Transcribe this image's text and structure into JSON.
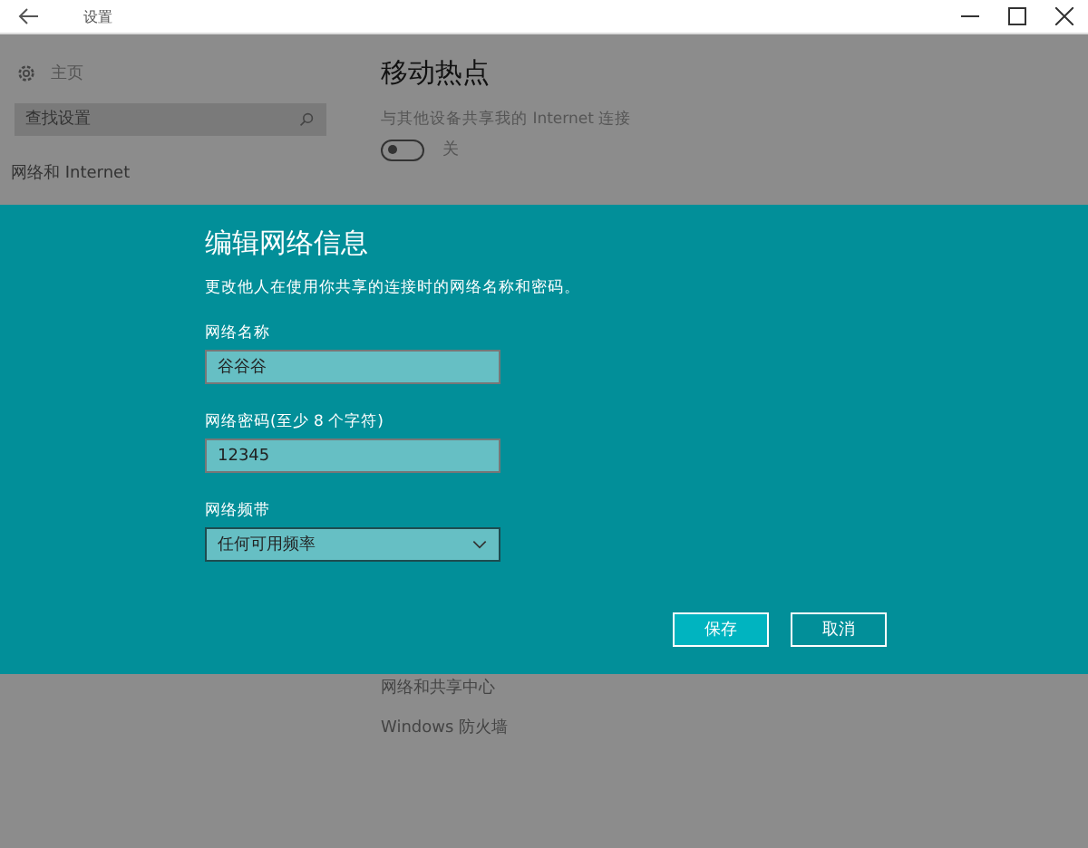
{
  "window": {
    "title": "设置"
  },
  "sidebar": {
    "home": "主页",
    "search": {
      "placeholder": "查找设置"
    },
    "section": "网络和 Internet"
  },
  "content": {
    "title": "移动热点",
    "share_label": "与其他设备共享我的 Internet 连接",
    "toggle": {
      "on": false,
      "label": "关"
    },
    "links": [
      "网络和共享中心",
      "Windows 防火墙"
    ]
  },
  "dialog": {
    "title": "编辑网络信息",
    "description": "更改他人在使用你共享的连接时的网络名称和密码。",
    "fields": [
      {
        "kind": "text",
        "label": "网络名称",
        "value": "谷谷谷"
      },
      {
        "kind": "text",
        "label": "网络密码(至少 8 个字符)",
        "value": "12345"
      },
      {
        "kind": "select",
        "label": "网络频带",
        "value": "任何可用频率"
      }
    ],
    "buttons": [
      {
        "label": "保存",
        "primary": true
      },
      {
        "label": "取消",
        "primary": false
      }
    ]
  }
}
